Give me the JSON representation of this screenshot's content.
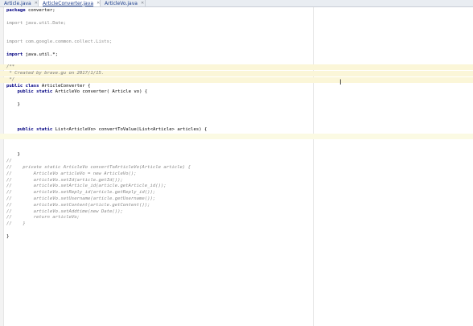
{
  "tabs": [
    {
      "label": "Article.java",
      "active": false
    },
    {
      "label": "ArticleConverter.java",
      "active": true
    },
    {
      "label": "ArticleVo.java",
      "active": false
    }
  ],
  "code": [
    {
      "text": "package converter;",
      "style": "plain"
    },
    {
      "text": "",
      "style": "plain"
    },
    {
      "text": "import java.util.Date;",
      "style": "dim"
    },
    {
      "text": "",
      "style": "plain"
    },
    {
      "text": "",
      "style": "plain"
    },
    {
      "text": "import com.google.common.collect.Lists;",
      "style": "dim"
    },
    {
      "text": "",
      "style": "plain"
    },
    {
      "text": "import java.util.*;",
      "style": "plain"
    },
    {
      "text": "",
      "style": "plain"
    },
    {
      "text": "/**",
      "style": "doc",
      "highlight": true
    },
    {
      "text": " * Created by brave.gu on 2017/1/15.",
      "style": "doc",
      "highlight": true
    },
    {
      "text": " */",
      "style": "doc",
      "highlight": true
    },
    {
      "text": "public class ArticleConverter {",
      "style": "plain"
    },
    {
      "text": "    public static ArticleVo converter( Article vo) {",
      "style": "plain"
    },
    {
      "text": "",
      "style": "plain"
    },
    {
      "text": "    }",
      "style": "plain"
    },
    {
      "text": "",
      "style": "plain"
    },
    {
      "text": "",
      "style": "plain"
    },
    {
      "text": "",
      "style": "plain"
    },
    {
      "text": "    public static List<ArticleVo> convertToValue(List<Article> articles) {",
      "style": "plain"
    },
    {
      "text": "",
      "style": "plain",
      "caret": true
    },
    {
      "text": "",
      "style": "plain"
    },
    {
      "text": "",
      "style": "plain"
    },
    {
      "text": "    }",
      "style": "plain"
    },
    {
      "text": "//",
      "style": "cm"
    },
    {
      "text": "//    private static ArticleVo convertToArticleVo(Article article) {",
      "style": "cm"
    },
    {
      "text": "//        ArticleVo articleVo = new ArticleVo();",
      "style": "cm"
    },
    {
      "text": "//        articleVo.setId(article.getId());",
      "style": "cm"
    },
    {
      "text": "//        articleVo.setArticle_id(article.getArticle_id());",
      "style": "cm"
    },
    {
      "text": "//        articleVo.setReply_id(article.getReply_id());",
      "style": "cm"
    },
    {
      "text": "//        articleVo.setUsername(article.getUsername());",
      "style": "cm"
    },
    {
      "text": "//        articleVo.setContent(article.getContent());",
      "style": "cm"
    },
    {
      "text": "//        articleVo.setAddtime(new Date());",
      "style": "cm"
    },
    {
      "text": "//        return articleVo;",
      "style": "cm"
    },
    {
      "text": "//    }",
      "style": "cm"
    },
    {
      "text": "",
      "style": "plain"
    },
    {
      "text": "}",
      "style": "plain"
    }
  ],
  "line_height_px": 7.8,
  "colors": {
    "keyword": "#000080",
    "comment": "#8a8a8a",
    "highlight": "#fbf6d8",
    "tab_active_text": "#1c3d8c"
  }
}
